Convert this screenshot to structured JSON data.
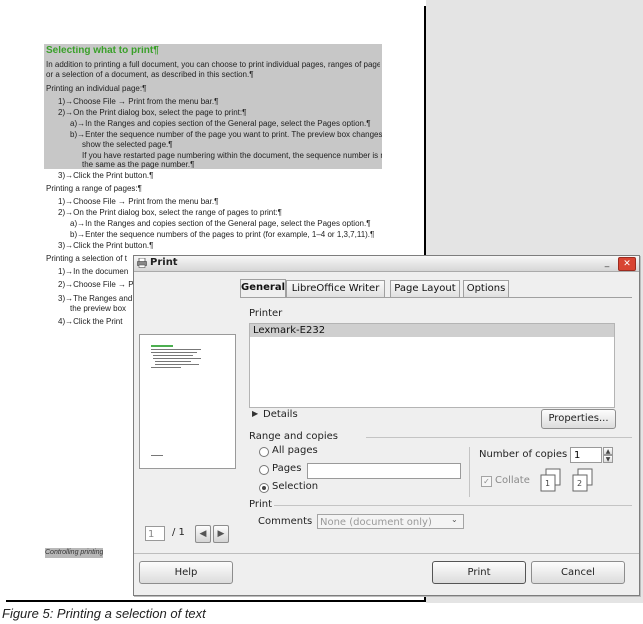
{
  "document": {
    "heading": "Selecting what to print¶",
    "lines": [
      "In addition to printing a full document, you can choose to print individual pages, ranges of pages,",
      "or a selection of a document, as described in this section.¶",
      "Printing an individual page:¶",
      "1)→Choose File → Print from the menu bar.¶",
      "2)→On the Print dialog box, select the page to print:¶",
      "a)→In the Ranges and copies section of the General page, select the Pages option.¶",
      "b)→Enter the sequence number of the page you want to print. The preview box changes to",
      "show the selected page.¶",
      "If you have restarted page numbering within the document, the sequence number is not",
      "the same as the page number.¶",
      "3)→Click the Print button.¶",
      "Printing a range of pages:¶",
      "1)→Choose File → Print from the menu bar.¶",
      "2)→On the Print dialog box, select the range of pages to print:¶",
      "a)→In the Ranges and copies section of the General page, select the Pages option.¶",
      "b)→Enter the sequence numbers of the pages to print (for example, 1–4 or 1,3,7,11).¶",
      "3)→Click the Print button.¶",
      "Printing a selection of t",
      "1)→In the documen",
      "2)→Choose File → P",
      "3)→The Ranges and",
      "the preview box",
      "4)→Click the Print"
    ],
    "footer": "Controlling printing"
  },
  "caption": "Figure 5: Printing a selection of text",
  "dialog": {
    "title": "Print",
    "minimize": "_",
    "close": "✕",
    "tabs": [
      "General",
      "LibreOffice Writer",
      "Page Layout",
      "Options"
    ],
    "printer_label": "Printer",
    "printer_name": "Lexmark-E232",
    "details_label": "Details",
    "properties_button": "Properties...",
    "range_label": "Range and copies",
    "all_pages": "All pages",
    "pages": "Pages",
    "selection": "Selection",
    "copies_label": "Number of copies",
    "copies_value": "1",
    "collate": "Collate",
    "print_section": "Print",
    "comments_label": "Comments",
    "comments_value": "None (document only)",
    "page_value": "1",
    "page_total": "/ 1",
    "help_button": "Help",
    "print_button": "Print",
    "cancel_button": "Cancel"
  }
}
